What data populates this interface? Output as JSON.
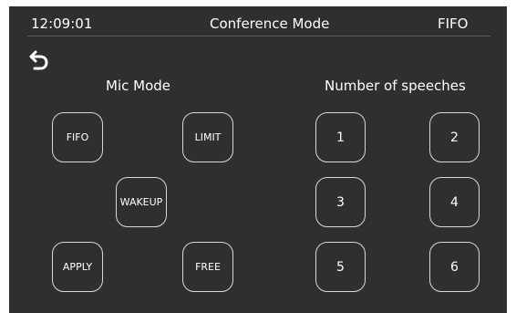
{
  "status_bar": {
    "time": "12:09:01",
    "title": "Conference Mode",
    "current_mode": "FIFO"
  },
  "back_icon": "undo-arrow-icon",
  "mic_mode": {
    "title": "Mic Mode",
    "buttons": [
      "FIFO",
      "LIMIT",
      "WAKEUP",
      "APPLY",
      "FREE"
    ]
  },
  "speeches": {
    "title": "Number of speeches",
    "buttons": [
      "1",
      "2",
      "3",
      "4",
      "5",
      "6"
    ]
  },
  "colors": {
    "background": "#2f2f31",
    "border": "#d8d8d8",
    "text": "#ffffff"
  }
}
